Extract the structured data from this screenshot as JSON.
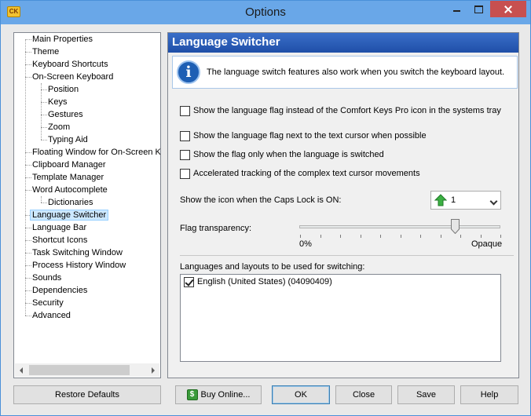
{
  "window": {
    "title": "Options",
    "app_icon_text": "CK"
  },
  "tree": {
    "items": [
      {
        "label": "Main Properties",
        "level": 0
      },
      {
        "label": "Theme",
        "level": 0
      },
      {
        "label": "Keyboard Shortcuts",
        "level": 0
      },
      {
        "label": "On-Screen Keyboard",
        "level": 0
      },
      {
        "label": "Position",
        "level": 1
      },
      {
        "label": "Keys",
        "level": 1
      },
      {
        "label": "Gestures",
        "level": 1
      },
      {
        "label": "Zoom",
        "level": 1
      },
      {
        "label": "Typing Aid",
        "level": 1
      },
      {
        "label": "Floating Window for On-Screen Keyboard",
        "level": 0
      },
      {
        "label": "Clipboard Manager",
        "level": 0
      },
      {
        "label": "Template Manager",
        "level": 0
      },
      {
        "label": "Word Autocomplete",
        "level": 0
      },
      {
        "label": "Dictionaries",
        "level": 1
      },
      {
        "label": "Language Switcher",
        "level": 0,
        "selected": true
      },
      {
        "label": "Language Bar",
        "level": 0
      },
      {
        "label": "Shortcut Icons",
        "level": 0
      },
      {
        "label": "Task Switching Window",
        "level": 0
      },
      {
        "label": "Process History Window",
        "level": 0
      },
      {
        "label": "Sounds",
        "level": 0
      },
      {
        "label": "Dependencies",
        "level": 0
      },
      {
        "label": "Security",
        "level": 0
      },
      {
        "label": "Advanced",
        "level": 0
      }
    ]
  },
  "panel": {
    "header": "Language Switcher",
    "info_text": "The language switch features also work when you switch the keyboard layout.",
    "checkboxes": [
      {
        "label": "Show the language flag instead of the Comfort Keys Pro icon in the systems tray",
        "checked": false
      },
      {
        "label": "Show the language flag next to the text cursor when possible",
        "checked": false
      },
      {
        "label": "Show the flag only when the language is switched",
        "checked": false
      },
      {
        "label": "Accelerated tracking of the complex text cursor movements",
        "checked": false
      }
    ],
    "caps_lock_label": "Show the icon when the Caps Lock is ON:",
    "caps_lock_value": "1",
    "transparency_label": "Flag transparency:",
    "transparency_min": "0%",
    "transparency_max": "Opaque",
    "transparency_value": 0.77,
    "languages_label": "Languages and layouts to be used for switching:",
    "languages": [
      {
        "label": "English (United States) (04090409)",
        "checked": true
      }
    ]
  },
  "buttons": {
    "restore_defaults": "Restore Defaults",
    "buy_online": "Buy Online...",
    "ok": "OK",
    "close": "Close",
    "save": "Save",
    "help": "Help"
  },
  "colors": {
    "titlebar": "#69a7e8",
    "panel_header": "#1f4fa8",
    "close_button": "#c75050"
  }
}
